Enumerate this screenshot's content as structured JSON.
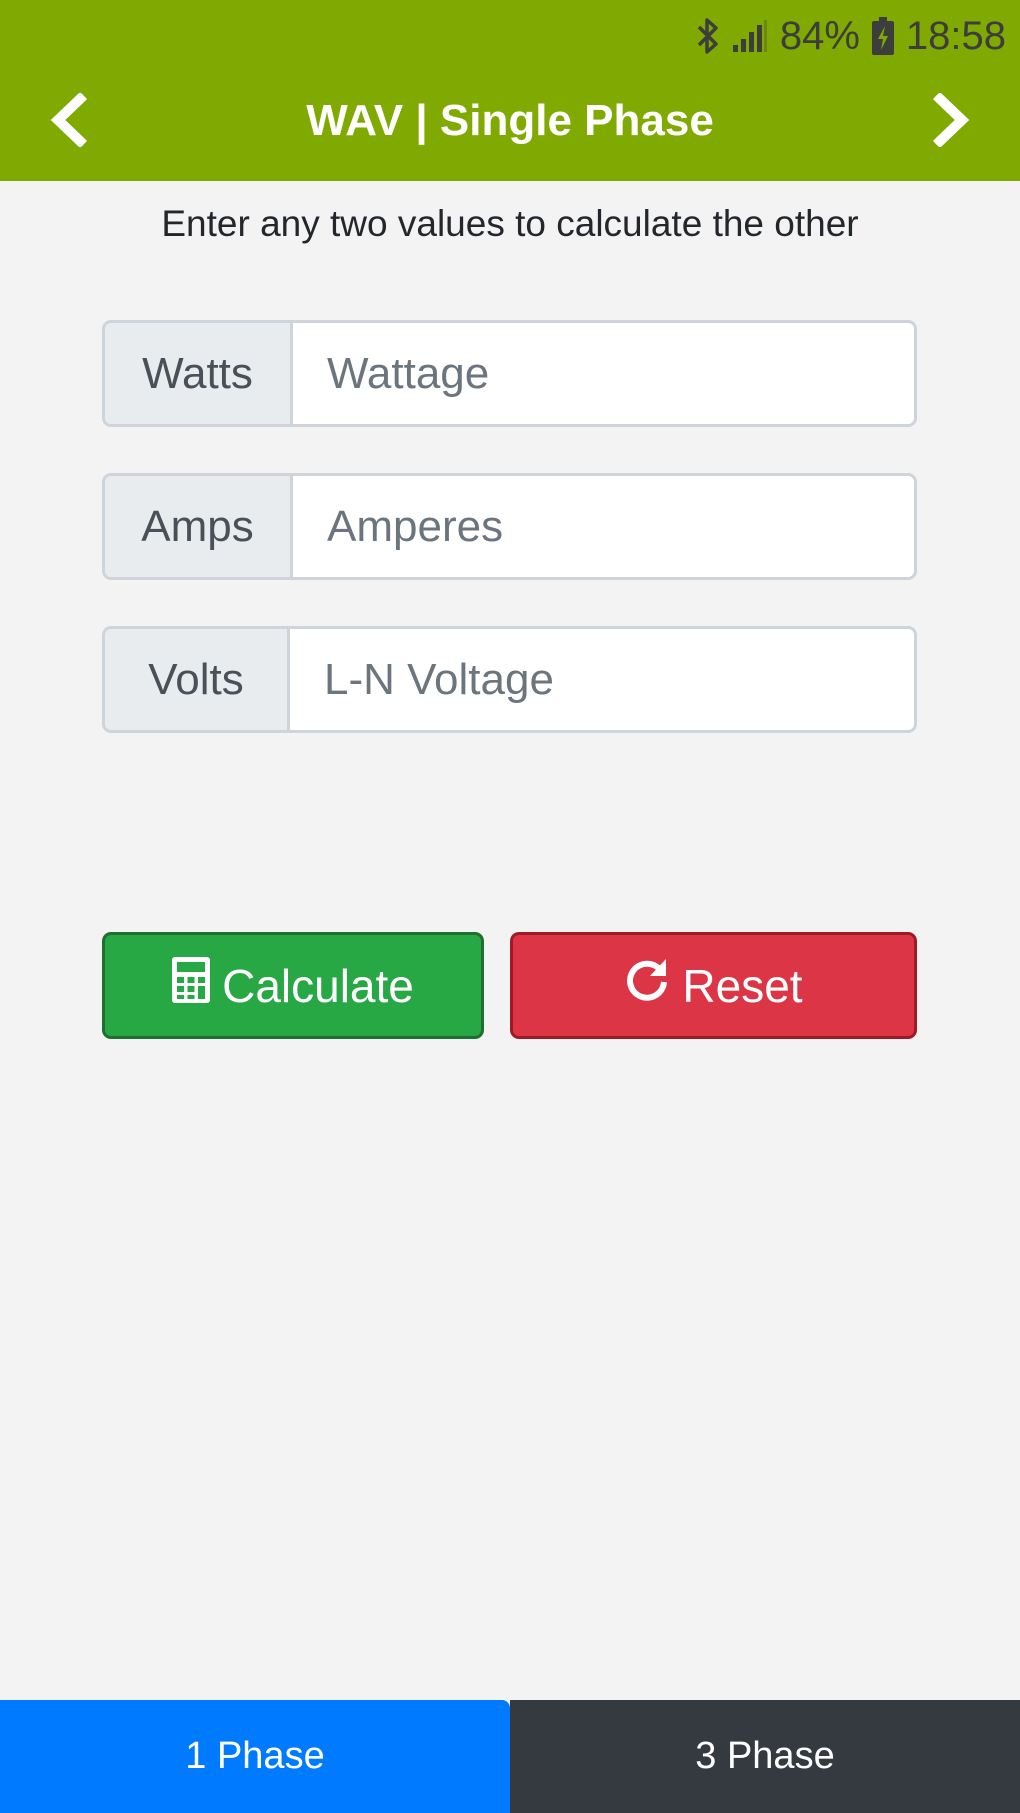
{
  "status_bar": {
    "battery": "84%",
    "time": "18:58",
    "icons": [
      "bluetooth-icon",
      "signal-icon",
      "battery-charging-icon"
    ]
  },
  "header": {
    "title": "WAV | Single Phase",
    "back_icon": "chevron-left-icon",
    "forward_icon": "chevron-right-icon",
    "color": "#80aa02"
  },
  "instruction": "Enter any two values to calculate the other",
  "fields": [
    {
      "label": "Watts",
      "placeholder": "Wattage",
      "value": ""
    },
    {
      "label": "Amps",
      "placeholder": "Amperes",
      "value": ""
    },
    {
      "label": "Volts",
      "placeholder": "L-N Voltage",
      "value": ""
    }
  ],
  "buttons": {
    "calculate": {
      "label": "Calculate",
      "icon": "calculator-icon",
      "color": "#28a745"
    },
    "reset": {
      "label": "Reset",
      "icon": "refresh-icon",
      "color": "#dc3545"
    }
  },
  "tabs": [
    {
      "label": "1 Phase",
      "active": true,
      "color": "#007bff"
    },
    {
      "label": "3 Phase",
      "active": false,
      "color": "#343a40"
    }
  ]
}
